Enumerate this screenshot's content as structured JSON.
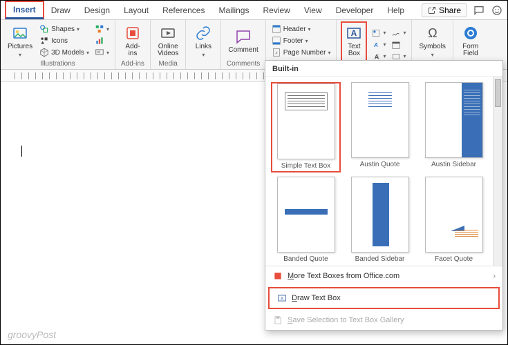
{
  "tabs": {
    "items": [
      "Insert",
      "Draw",
      "Design",
      "Layout",
      "References",
      "Mailings",
      "Review",
      "View",
      "Developer",
      "Help"
    ],
    "active": 0
  },
  "title_actions": {
    "share": "Share"
  },
  "ribbon": {
    "illustrations": {
      "label": "Illustrations",
      "pictures": "Pictures",
      "shapes": "Shapes",
      "icons": "Icons",
      "models3d": "3D Models"
    },
    "addins": {
      "label": "Add-ins",
      "btn": "Add-\nins"
    },
    "media": {
      "label": "Media",
      "btn": "Online\nVideos"
    },
    "links": {
      "label": "",
      "btn": "Links"
    },
    "comments": {
      "label": "Comments",
      "btn": "Comment"
    },
    "headerfooter": {
      "header": "Header",
      "footer": "Footer",
      "pagenum": "Page Number"
    },
    "text": {
      "textbox": "Text\nBox"
    },
    "symbols": {
      "label": "Symbols",
      "btn": "Symbols"
    },
    "form": {
      "label": "",
      "btn": "Form\nField"
    }
  },
  "dropdown": {
    "header": "Built-in",
    "items": [
      {
        "label": "Simple Text Box"
      },
      {
        "label": "Austin Quote"
      },
      {
        "label": "Austin Sidebar"
      },
      {
        "label": "Banded Quote"
      },
      {
        "label": "Banded Sidebar"
      },
      {
        "label": "Facet Quote"
      }
    ],
    "more": "More Text Boxes from Office.com",
    "draw": "Draw Text Box",
    "save": "Save Selection to Text Box Gallery"
  },
  "watermark": "groovyPost"
}
